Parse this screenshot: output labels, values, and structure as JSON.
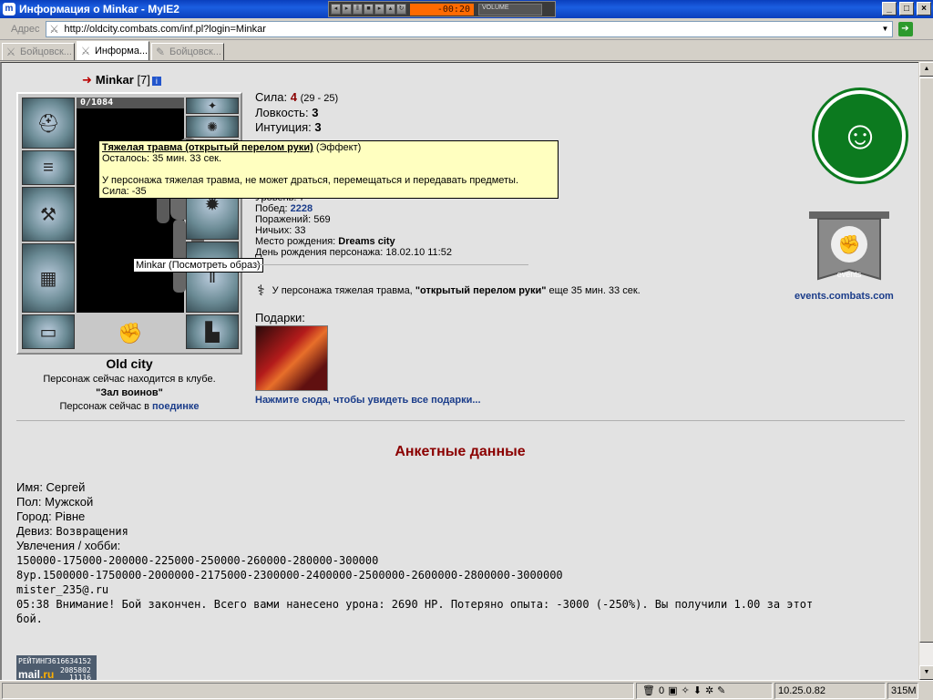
{
  "window": {
    "title": "Информация о Minkar - MyIE2",
    "player_time": "-00:20",
    "player_volume_label": "VOLUME",
    "buttons": [
      "_",
      "□",
      "×"
    ]
  },
  "address": {
    "label": "Адрес",
    "url": "http://oldcity.combats.com/inf.pl?login=Minkar"
  },
  "tabs": [
    {
      "label": "Бойцовск...",
      "active": false
    },
    {
      "label": "Информа...",
      "active": true
    },
    {
      "label": "Бойцовск...",
      "active": false
    }
  ],
  "character": {
    "name": "Minkar",
    "level": "[7]",
    "hp": "0/1084",
    "avatar_tooltip": "Minkar (Посмотреть образ)"
  },
  "city": {
    "name": "Old city",
    "club_line": "Персонаж сейчас находится в клубе.",
    "club_room": "\"Зал воинов\"",
    "battle_prefix": "Персонаж сейчас в",
    "battle_link": "поединке"
  },
  "stats": [
    {
      "label": "Сила:",
      "value": "4",
      "extra": "(29 - 25)"
    },
    {
      "label": "Ловкость:",
      "value": "3",
      "extra": ""
    },
    {
      "label": "Интуиция:",
      "value": "3",
      "extra": ""
    }
  ],
  "effect_tooltip": {
    "title": "Тяжелая травма (открытый перелом руки)",
    "title_suffix": "(Эффект)",
    "remaining": "Осталось: 35 мин. 33 сек.",
    "description": "У персонажа тяжелая травма, не может драться, перемещаться и передавать предметы.",
    "stat": "Сила: -35"
  },
  "details": {
    "level_label": "Уровень: 7",
    "wins_label": "Побед:",
    "wins_value": "2228",
    "losses": "Поражений: 569",
    "draws": "Ничьих: 33",
    "birthplace_label": "Место рождения:",
    "birthplace_value": "Dreams city",
    "birthday": "День рождения персонажа: 18.02.10 11:52"
  },
  "trauma": {
    "prefix": "У персонажа тяжелая травма,",
    "name": "\"открытый перелом руки\"",
    "suffix": "еще 35 мин. 33 сек."
  },
  "gifts": {
    "label": "Подарки:",
    "link": "Нажмите сюда, чтобы увидеть все подарки...",
    "image_text": ""
  },
  "events": {
    "emblem_text": "events",
    "link": "events.combats.com"
  },
  "anketa": {
    "title": "Анкетные данные",
    "name": "Имя: Сергей",
    "gender": "Пол: Мужской",
    "city": "Город: Рівне",
    "motto_label": "Девиз:",
    "motto_value": "Возвращения",
    "hobby_label": "Увлечения / хобби:",
    "hobby_lines": [
      "150000-175000-200000-225000-250000-260000-280000-300000",
      "8ур.1500000-1750000-2000000-2175000-2300000-2400000-2500000-2600000-2800000-3000000",
      "mister_235@.ru",
      "05:38 Внимание! Бой закончен. Всего вами нанесено урона: 2690 HP. Потеряно опыта: -3000 (-250%). Вы получили 1.00 за этот",
      "бой."
    ]
  },
  "rating": {
    "label": "РЕЙТИНГ",
    "n1": "3616634152",
    "mail_a": "mail",
    "mail_b": ".ru",
    "n2": "2085802",
    "n3": "11116"
  },
  "statusbar": {
    "main": "",
    "trash_count": "0",
    "ip": "10.25.0.82",
    "memory": "315M"
  }
}
